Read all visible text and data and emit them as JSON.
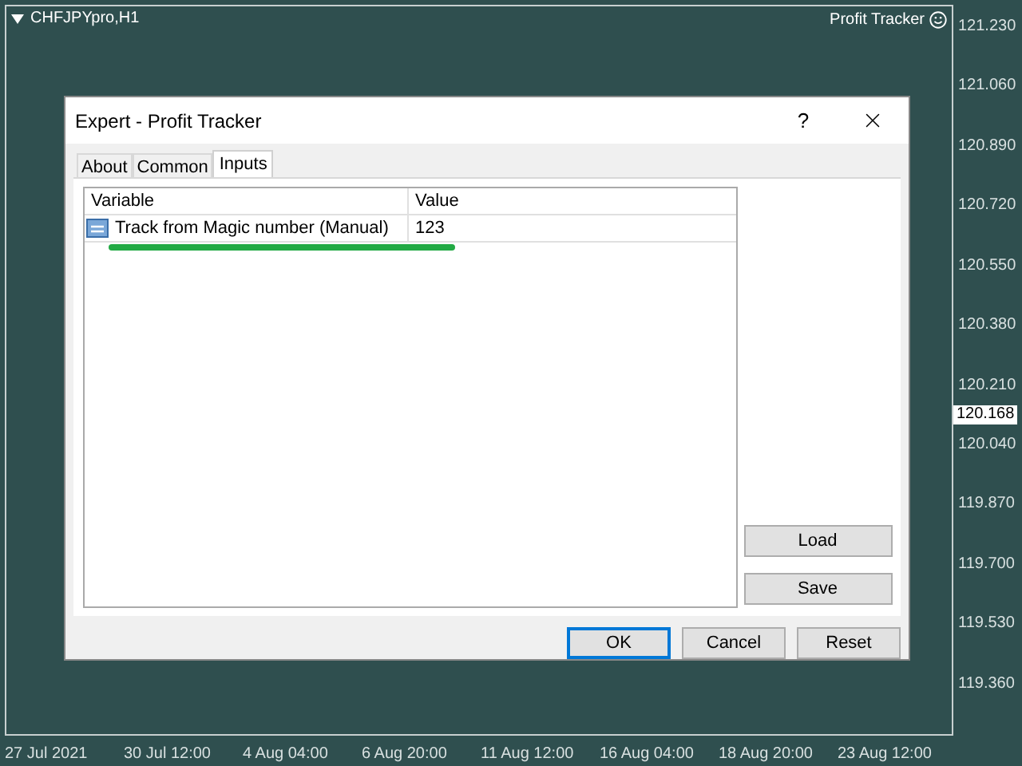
{
  "chart": {
    "symbol": "CHFJPYpro,H1",
    "indicator": "Profit Tracker",
    "price_ticks": [
      "121.230",
      "121.060",
      "120.890",
      "120.720",
      "120.550",
      "120.380",
      "120.210",
      "120.040",
      "119.870",
      "119.700",
      "119.530",
      "119.360"
    ],
    "current_price": "120.168",
    "time_ticks": [
      "27 Jul 2021",
      "30 Jul 12:00",
      "4 Aug 04:00",
      "6 Aug 20:00",
      "11 Aug 12:00",
      "16 Aug 04:00",
      "18 Aug 20:00",
      "23 Aug 12:00"
    ]
  },
  "dialog": {
    "title": "Expert - Profit Tracker",
    "help": "?",
    "tabs": [
      {
        "label": "About",
        "selected": false
      },
      {
        "label": "Common",
        "selected": false
      },
      {
        "label": "Inputs",
        "selected": true
      }
    ],
    "table": {
      "columns": [
        "Variable",
        "Value"
      ],
      "rows": [
        {
          "variable": "Track from Magic number (Manual)",
          "value": "123"
        }
      ]
    },
    "side_buttons": [
      "Load",
      "Save"
    ],
    "buttons": [
      {
        "label": "OK",
        "default": true
      },
      {
        "label": "Cancel",
        "default": false
      },
      {
        "label": "Reset",
        "default": false
      }
    ]
  }
}
